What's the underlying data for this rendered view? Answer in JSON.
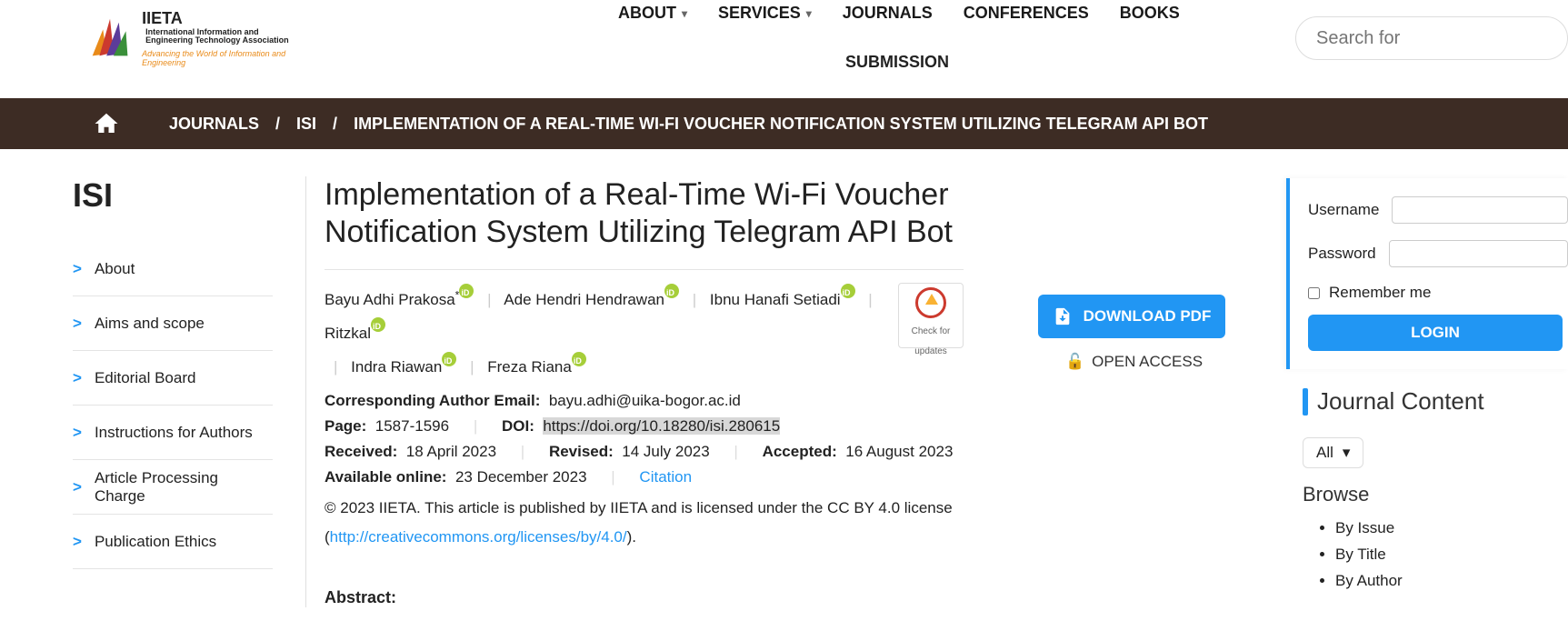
{
  "logo": {
    "acronym": "IIETA",
    "full_name_1": "International Information and",
    "full_name_2": "Engineering Technology Association",
    "tagline": "Advancing the World of Information and Engineering"
  },
  "nav": {
    "about": "ABOUT",
    "services": "SERVICES",
    "journals": "JOURNALS",
    "conferences": "CONFERENCES",
    "books": "BOOKS",
    "submission": "SUBMISSION"
  },
  "search": {
    "placeholder": "Search for"
  },
  "breadcrumb": {
    "journals": "JOURNALS",
    "isi": "ISI",
    "title": "IMPLEMENTATION OF A REAL-TIME WI-FI VOUCHER NOTIFICATION SYSTEM UTILIZING TELEGRAM API BOT"
  },
  "sidebar": {
    "heading": "ISI",
    "items": [
      {
        "label": "About"
      },
      {
        "label": "Aims and scope"
      },
      {
        "label": "Editorial Board"
      },
      {
        "label": "Instructions for Authors"
      },
      {
        "label": "Article Processing Charge"
      },
      {
        "label": "Publication Ethics"
      }
    ]
  },
  "article": {
    "title": "Implementation of a Real-Time Wi-Fi Voucher Notification System Utilizing Telegram API Bot",
    "authors": [
      {
        "name": "Bayu Adhi Prakosa",
        "corresponding": true
      },
      {
        "name": "Ade Hendri Hendrawan"
      },
      {
        "name": "Ibnu Hanafi Setiadi"
      },
      {
        "name": "Ritzkal"
      },
      {
        "name": "Indra Riawan"
      },
      {
        "name": "Freza Riana"
      }
    ],
    "check_updates_l1": "Check for",
    "check_updates_l2": "updates",
    "corr_label": "Corresponding Author Email:",
    "corr_email": "bayu.adhi@uika-bogor.ac.id",
    "page_label": "Page:",
    "page": "1587-1596",
    "doi_label": "DOI:",
    "doi": "https://doi.org/10.18280/isi.280615",
    "received_label": "Received:",
    "received": "18 April 2023",
    "revised_label": "Revised:",
    "revised": "14 July 2023",
    "accepted_label": "Accepted:",
    "accepted": "16 August 2023",
    "online_label": "Available online:",
    "online": "23 December 2023",
    "citation": "Citation",
    "license_pre": "© 2023 IIETA. This article is published by IIETA and is licensed under the CC BY 4.0 license (",
    "license_url": "http://creativecommons.org/licenses/by/4.0/",
    "license_post": ").",
    "abstract_heading": "Abstract:"
  },
  "right": {
    "download": "DOWNLOAD PDF",
    "openaccess": "OPEN ACCESS"
  },
  "login": {
    "username_label": "Username",
    "password_label": "Password",
    "remember": "Remember me",
    "login_button": "LOGIN"
  },
  "journal_content": {
    "heading": "Journal Content",
    "all": "All",
    "browse": "Browse",
    "by_issue": "By Issue",
    "by_title": "By Title",
    "by_author": "By Author"
  }
}
